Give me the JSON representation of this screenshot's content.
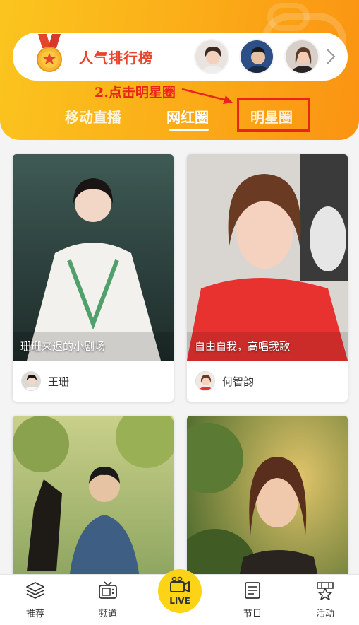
{
  "header": {
    "rank_title": "人气排行榜",
    "annotation": "2.点击明星圈"
  },
  "tabs": [
    {
      "label": "移动直播",
      "active": false
    },
    {
      "label": "网红圈",
      "active": true
    },
    {
      "label": "明星圈",
      "active": false,
      "highlighted": true
    }
  ],
  "cards": [
    {
      "caption": "珊珊来迟的小剧场",
      "name": "王珊"
    },
    {
      "caption": "自由自我，高唱我歌",
      "name": "何智韵"
    },
    {
      "caption": "",
      "name": ""
    },
    {
      "caption": "",
      "name": ""
    }
  ],
  "bottom_nav": [
    {
      "label": "推荐",
      "icon": "layers-icon"
    },
    {
      "label": "频道",
      "icon": "tv-icon"
    },
    {
      "label": "LIVE",
      "icon": "camera-icon"
    },
    {
      "label": "节目",
      "icon": "document-icon"
    },
    {
      "label": "活动",
      "icon": "star-flag-icon"
    }
  ],
  "colors": {
    "header_gradient_start": "#fbc51e",
    "header_gradient_end": "#fb9312",
    "accent_red": "#e8241b",
    "live_yellow": "#fcd315"
  }
}
